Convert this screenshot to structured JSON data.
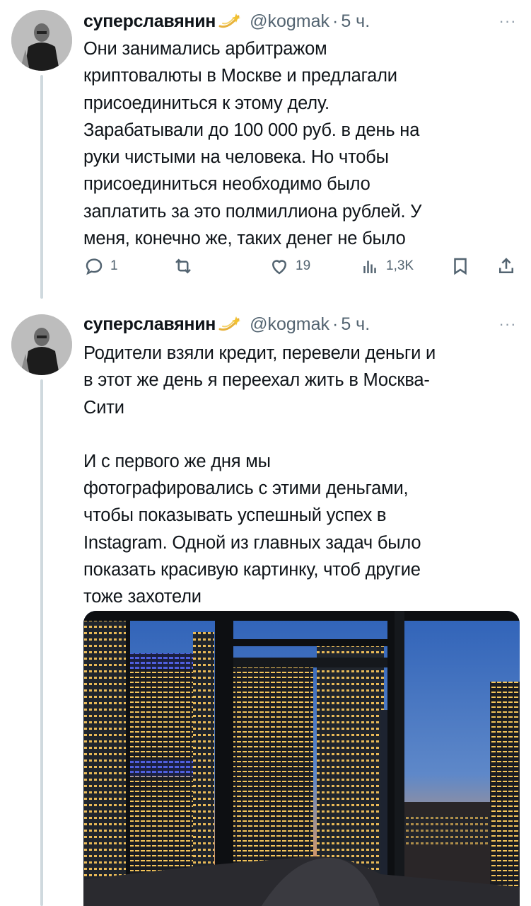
{
  "tweets": [
    {
      "display_name": "суперславянин",
      "badge_emoji": "💫",
      "handle": "@kogmak",
      "separator": "·",
      "time": "5 ч.",
      "more": "···",
      "paragraphs": [
        "Они занимались арбитражом\nкриптовалюты в Москве и предлагали\nприсоединиться к этому делу.\nЗарабатывали до 100 000 руб. в день на\nруки чистыми на человека. Но чтобы\nприсоединиться необходимо было\nзаплатить за это полмиллиона рублей. У\nменя, конечно же, таких денег не было"
      ],
      "actions": {
        "replies": "1",
        "retweets": "",
        "likes": "19",
        "views": "1,3K"
      }
    },
    {
      "display_name": "суперславянин",
      "badge_emoji": "💫",
      "handle": "@kogmak",
      "separator": "·",
      "time": "5 ч.",
      "more": "···",
      "paragraphs": [
        "Родители взяли кредит, перевели деньги и\nв этот же день я переехал жить в Москва-\nСити",
        "И с первого же дня мы\nфотографировались с этими деньгами,\nчтобы показывать успешный успех в\nInstagram. Одной из главных задач было\nпоказать красивую картинку, чтоб другие\nтоже захотели"
      ],
      "media": {
        "colors": {
          "sky_top": "#3b6fc4",
          "sky_bottom": "#f2a05a",
          "frame": "#111418",
          "window_light": "#f6c760"
        }
      }
    }
  ]
}
